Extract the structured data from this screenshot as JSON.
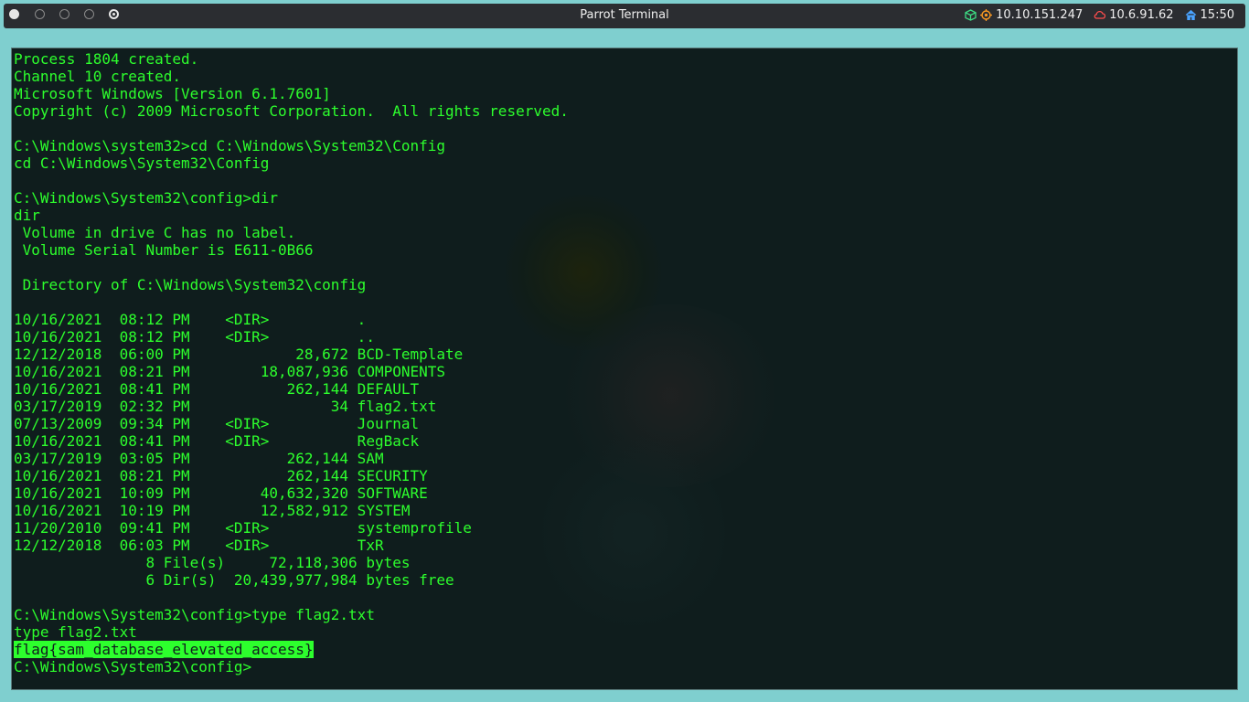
{
  "topbar": {
    "title": "Parrot Terminal",
    "status": {
      "target_ip": "10.10.151.247",
      "vpn_ip": "10.6.91.62",
      "time": "15:50"
    },
    "icons": {
      "cube": "cube-icon",
      "target": "target-icon",
      "vpn": "cloud-icon",
      "home": "home-icon"
    },
    "colors": {
      "cube": "#3ddc84",
      "target": "#ff9b21",
      "vpn": "#ff4d4d",
      "home": "#4aa3ff"
    }
  },
  "terminal": {
    "colors": {
      "text": "#2dff2d",
      "background": "#0f1d1d",
      "highlight": "#2dff2d"
    },
    "lines_before": [
      "Process 1804 created.",
      "Channel 10 created.",
      "Microsoft Windows [Version 6.1.7601]",
      "Copyright (c) 2009 Microsoft Corporation.  All rights reserved.",
      "",
      "C:\\Windows\\system32>cd C:\\Windows\\System32\\Config",
      "cd C:\\Windows\\System32\\Config",
      "",
      "C:\\Windows\\System32\\config>dir",
      "dir",
      " Volume in drive C has no label.",
      " Volume Serial Number is E611-0B66",
      "",
      " Directory of C:\\Windows\\System32\\config",
      "",
      "10/16/2021  08:12 PM    <DIR>          .",
      "10/16/2021  08:12 PM    <DIR>          ..",
      "12/12/2018  06:00 PM            28,672 BCD-Template",
      "10/16/2021  08:21 PM        18,087,936 COMPONENTS",
      "10/16/2021  08:41 PM           262,144 DEFAULT",
      "03/17/2019  02:32 PM                34 flag2.txt",
      "07/13/2009  09:34 PM    <DIR>          Journal",
      "10/16/2021  08:41 PM    <DIR>          RegBack",
      "03/17/2019  03:05 PM           262,144 SAM",
      "10/16/2021  08:21 PM           262,144 SECURITY",
      "10/16/2021  10:09 PM        40,632,320 SOFTWARE",
      "10/16/2021  10:19 PM        12,582,912 SYSTEM",
      "11/20/2010  09:41 PM    <DIR>          systemprofile",
      "12/12/2018  06:03 PM    <DIR>          TxR",
      "               8 File(s)     72,118,306 bytes",
      "               6 Dir(s)  20,439,977,984 bytes free",
      "",
      "C:\\Windows\\System32\\config>type flag2.txt",
      "type flag2.txt"
    ],
    "highlighted_line": "flag{sam_database_elevated_access}",
    "prompt": "C:\\Windows\\System32\\config>"
  }
}
